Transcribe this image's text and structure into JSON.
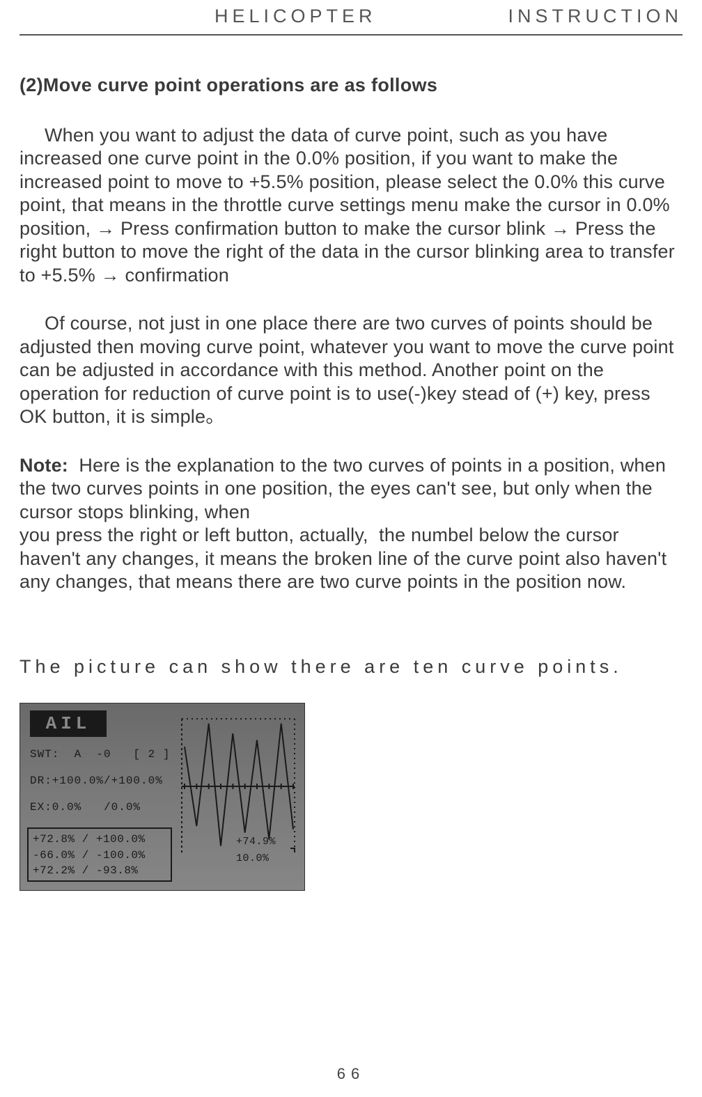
{
  "header": {
    "left": "HELICOPTER",
    "right": "INSTRUCTION"
  },
  "section_title": "(2)Move curve point operations are as follows",
  "para1": "When you want to adjust the data of curve point, such as you have increased one curve point in the 0.0% position, if you want to make the increased point to move to +5.5% position, please select the 0.0% this curve point, that means in the throttle curve settings menu make the cursor in 0.0% position, → Press confirmation button to make the cursor blink → Press the right button to move the right of the data in the cursor blinking area to transfer to +5.5% → confirmation",
  "para2": "Of course, not just in one place there are two curves of points should be adjusted then  moving curve point, whatever you want to move the curve point can be adjusted in accordance with this method. Another point on the operation for reduction of curve point is to use(-)key stead of (+) key, press OK button, it is simple。",
  "note_label": "Note:",
  "note_body": "  Here is the explanation to the two curves of points in a position, when the two curves points in one position, the eyes can't see, but only when the cursor stops blinking, when\nyou press the right or left button, actually,  the numbel below the cursor haven't any changes, it means the broken line of the curve point also haven't any changes, that means there are two curve points in the position now.",
  "caption": "The  picture  can  show  there  are  ten  curve  points.",
  "lcd": {
    "title": "AIL",
    "swt": "SWT:  A  -0   [ 2 ]",
    "dr": "DR:+100.0%/+100.0%",
    "ex": "EX:0.0%   /0.0%",
    "box1": "+72.8% / +100.0%",
    "box2": "-66.0% / -100.0%",
    "box3": "+72.2% / -93.8%",
    "value_top": "+74.9%",
    "value_bot": "10.0%"
  },
  "page_number": "66",
  "chart_data": {
    "type": "line",
    "title": "AIL curve display",
    "xlabel": "",
    "ylabel": "",
    "x": [
      0,
      1,
      2,
      3,
      4,
      5,
      6,
      7,
      8,
      9
    ],
    "values": [
      60,
      -60,
      95,
      -90,
      80,
      -70,
      70,
      -80,
      95,
      -65
    ],
    "ylim": [
      -100,
      100
    ],
    "grid": false,
    "annotations": [
      "+74.9%",
      "10.0%"
    ]
  }
}
